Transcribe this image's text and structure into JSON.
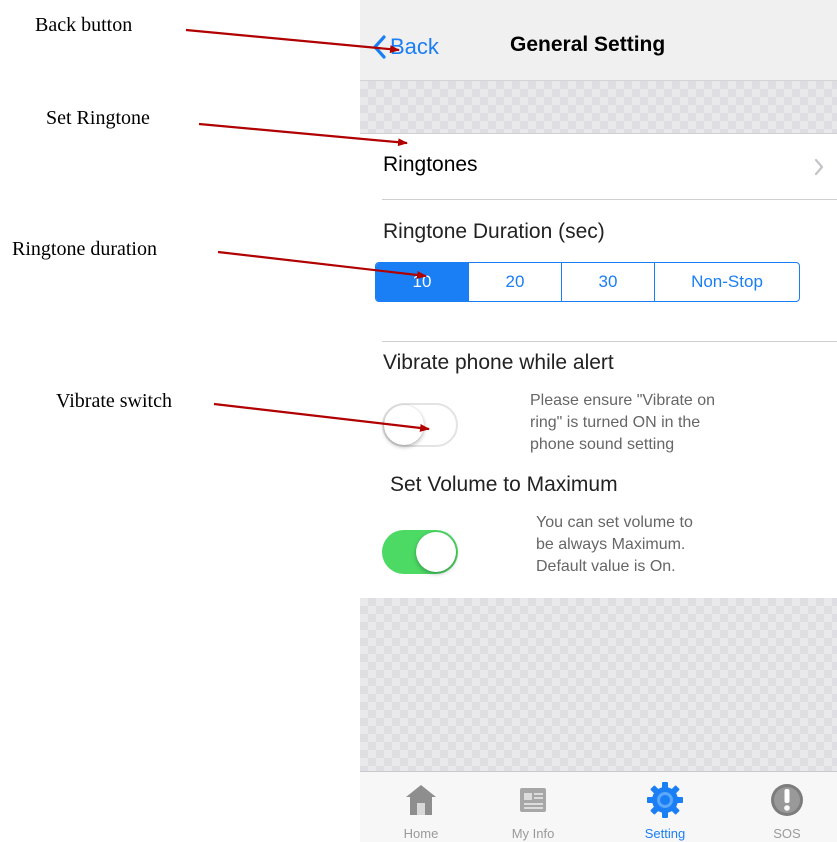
{
  "annotations": {
    "back_button": "Back button",
    "set_ringtone": "Set Ringtone",
    "ringtone_duration": "Ringtone duration",
    "vibrate_switch": "Vibrate switch"
  },
  "nav": {
    "back_label": "Back",
    "title": "General Setting"
  },
  "ringtones": {
    "label": "Ringtones"
  },
  "duration": {
    "label": "Ringtone Duration (sec)",
    "options": [
      "10",
      "20",
      "30",
      "Non-Stop"
    ],
    "selected": "10"
  },
  "vibrate": {
    "label": "Vibrate phone while alert",
    "note_lines": [
      "Please ensure \"Vibrate on",
      "ring\" is turned ON in the",
      "phone sound setting"
    ],
    "state": "off"
  },
  "volume": {
    "label": "Set Volume to Maximum",
    "note_lines": [
      "You can set volume to",
      "be always Maximum.",
      "Default value is On."
    ],
    "state": "on"
  },
  "tabs": [
    {
      "label": "Home",
      "icon": "home-icon"
    },
    {
      "label": "My Info",
      "icon": "news-icon"
    },
    {
      "label": "Setting",
      "icon": "gear-icon"
    },
    {
      "label": "SOS",
      "icon": "alert-icon"
    }
  ],
  "active_tab": "Setting",
  "colors": {
    "accent": "#1a7ef5",
    "toggle_on": "#4cd964",
    "annotation_arrow": "#c00000"
  }
}
